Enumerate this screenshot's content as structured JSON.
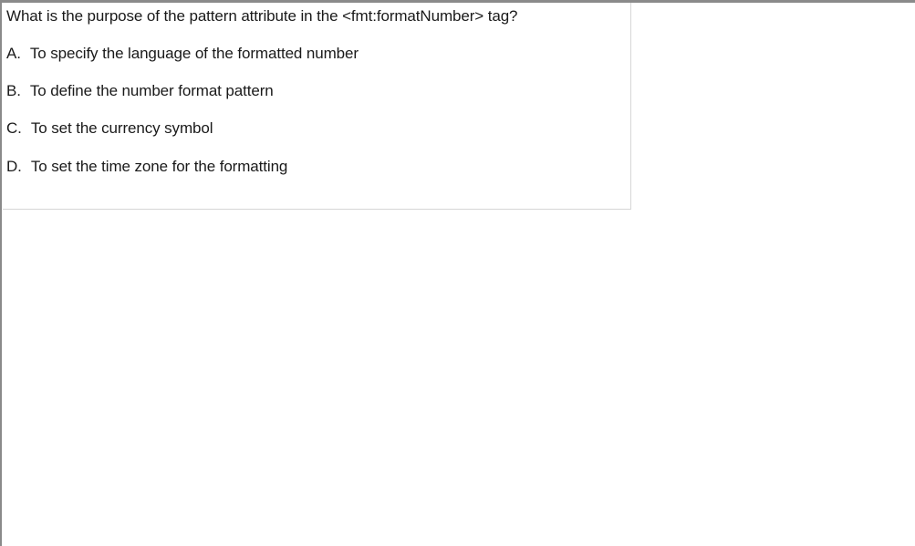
{
  "question": {
    "text": "What is the purpose of the pattern attribute in the <fmt:formatNumber> tag?"
  },
  "options": [
    {
      "letter": "A.",
      "text": "To specify the language of the formatted number"
    },
    {
      "letter": "B.",
      "text": "To define the number format pattern"
    },
    {
      "letter": "C.",
      "text": "To set the currency symbol"
    },
    {
      "letter": "D.",
      "text": "To set the time zone for the formatting"
    }
  ]
}
